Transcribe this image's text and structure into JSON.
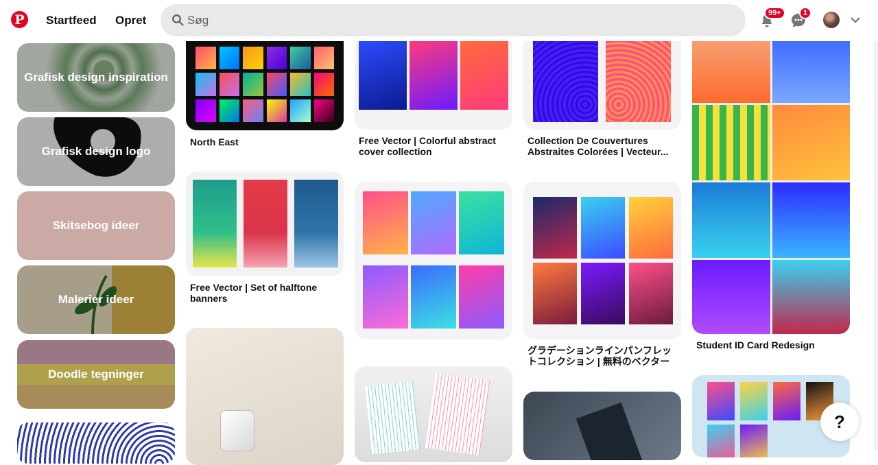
{
  "header": {
    "home_label": "Startfeed",
    "create_label": "Opret",
    "search_placeholder": "Søg",
    "notifications_badge": "99+",
    "messages_badge": "1"
  },
  "boards": [
    {
      "label": "Grafisk design inspiration"
    },
    {
      "label": "Grafisk design logo"
    },
    {
      "label": "Skitsebog ideer"
    },
    {
      "label": "Malerier ideer"
    },
    {
      "label": "Doodle tegninger"
    }
  ],
  "pins": [
    {
      "title": "North East"
    },
    {
      "title": "Free Vector | Set of halftone banners"
    },
    {
      "title": "Free Vector | Colorful abstract cover collection"
    },
    {
      "title": "Collection De Couvertures Abstraites Colorées | Vecteur..."
    },
    {
      "title": "グラデーションラインパンフレットコレクション | 無料のベクター"
    },
    {
      "title": "Student ID Card Redesign"
    }
  ],
  "help_label": "?",
  "colors": {
    "brand": "#e60023",
    "search_bg": "#e9e9e9"
  }
}
